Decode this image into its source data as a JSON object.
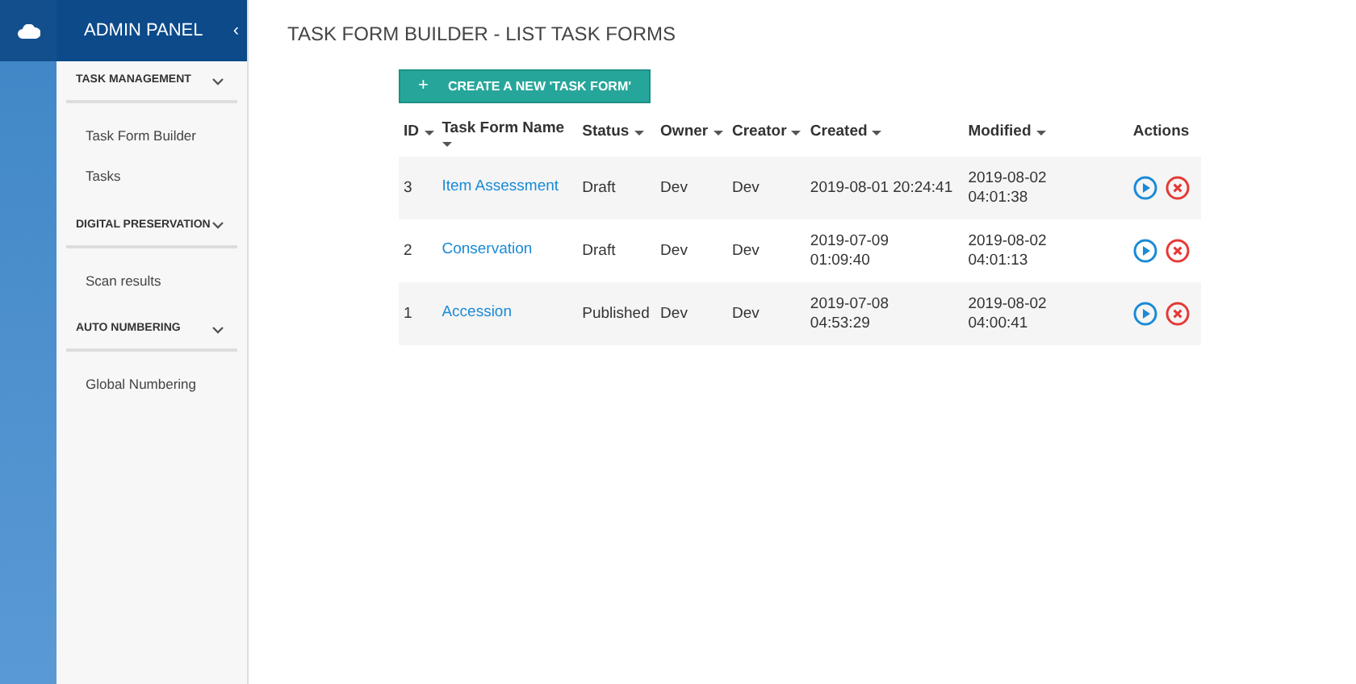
{
  "sidebar": {
    "title": "ADMIN PANEL",
    "collapse": "‹",
    "sections": [
      {
        "title": "TASK MANAGEMENT",
        "expanded": true,
        "items": [
          "Task Form Builder",
          "Tasks"
        ]
      },
      {
        "title": "DIGITAL PRESERVATION",
        "expanded": true,
        "items": [
          "Scan results"
        ]
      },
      {
        "title": "AUTO NUMBERING",
        "expanded": true,
        "items": [
          "Global Numbering"
        ]
      }
    ]
  },
  "page_title": "TASK FORM BUILDER - LIST TASK FORMS",
  "create_button": {
    "icon": "+",
    "label": "CREATE A NEW 'TASK FORM'"
  },
  "table": {
    "columns": [
      {
        "label": "ID",
        "kind": "sortable"
      },
      {
        "label": "Task Form Name",
        "kind": "caret_below"
      },
      {
        "label": "Status",
        "kind": "sortable"
      },
      {
        "label": "Owner",
        "kind": "sortable"
      },
      {
        "label": "Creator",
        "kind": "sortable"
      },
      {
        "label": "Created",
        "kind": "sortable"
      },
      {
        "label": "Modified",
        "kind": "sortable"
      },
      {
        "label": "Actions",
        "kind": "plain"
      }
    ],
    "rows": [
      {
        "id": "3",
        "name": "Item Assessment",
        "status": "Draft",
        "owner": "Dev",
        "creator": "Dev",
        "created": "2019-08-01 20:24:41",
        "modified": "2019-08-02 04:01:38"
      },
      {
        "id": "2",
        "name": "Conservation",
        "status": "Draft",
        "owner": "Dev",
        "creator": "Dev",
        "created": "2019-07-09 01:09:40",
        "modified": "2019-08-02 04:01:13"
      },
      {
        "id": "1",
        "name": "Accession",
        "status": "Published",
        "owner": "Dev",
        "creator": "Dev",
        "created": "2019-07-08 04:53:29",
        "modified": "2019-08-02 04:00:41"
      }
    ]
  }
}
